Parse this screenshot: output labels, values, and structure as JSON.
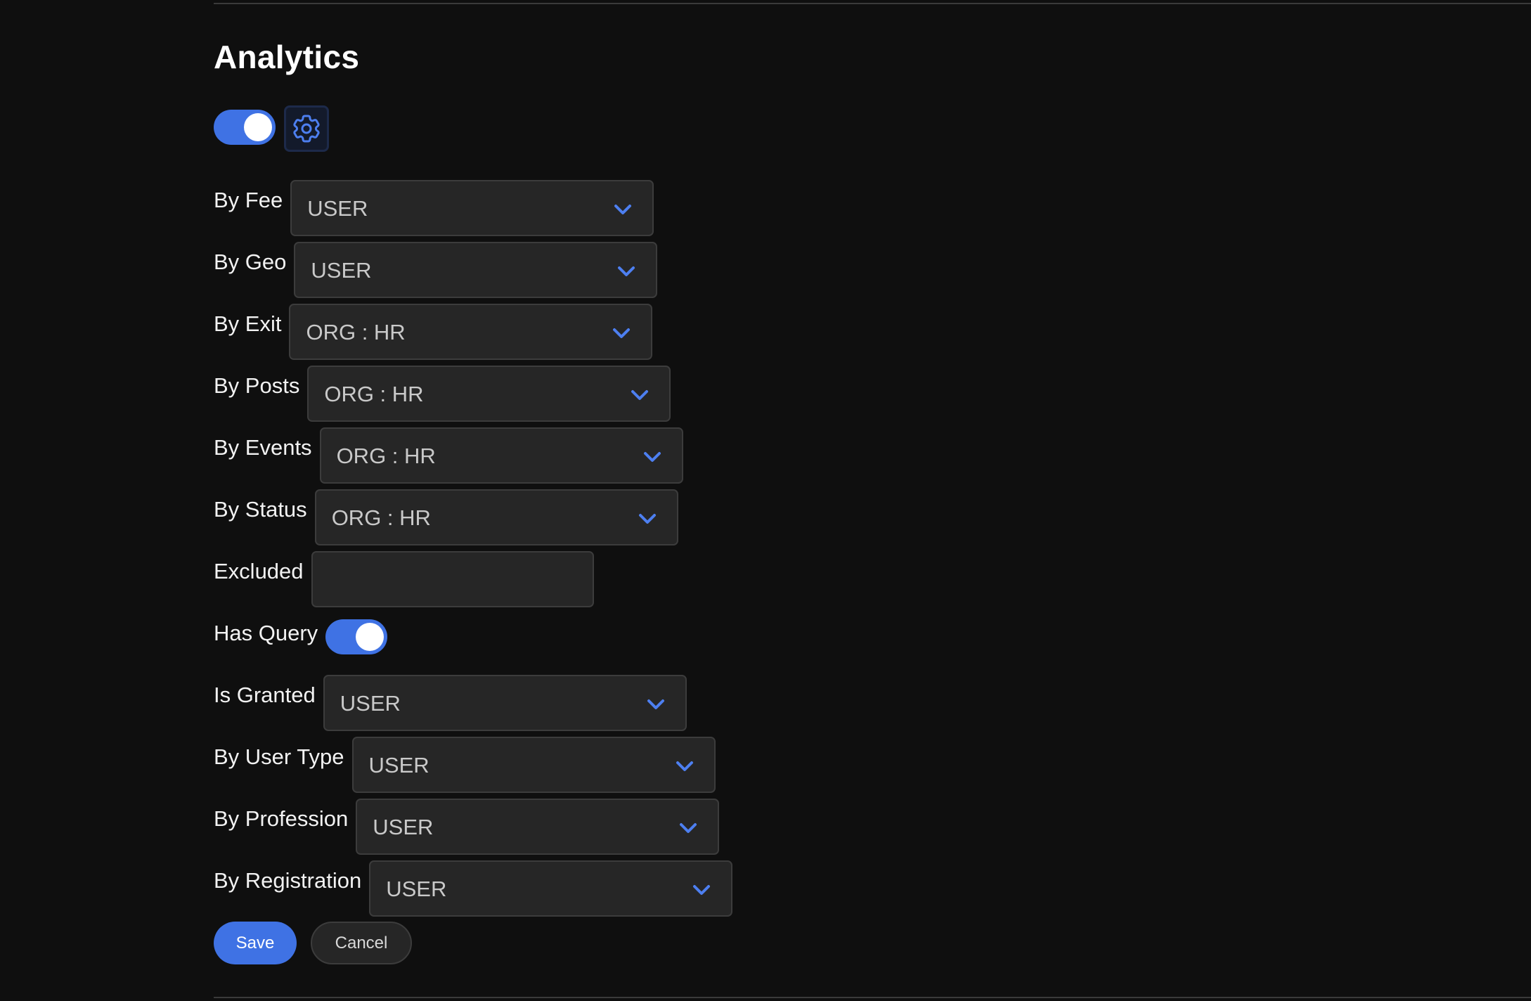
{
  "section": {
    "title": "Analytics",
    "enabled": true,
    "settings_icon": "gear-icon"
  },
  "fields": [
    {
      "label": "By Fee",
      "type": "select",
      "value": "USER"
    },
    {
      "label": "By Geo",
      "type": "select",
      "value": "USER"
    },
    {
      "label": "By Exit",
      "type": "select",
      "value": "ORG : HR"
    },
    {
      "label": "By Posts",
      "type": "select",
      "value": "ORG : HR"
    },
    {
      "label": "By Events",
      "type": "select",
      "value": "ORG : HR"
    },
    {
      "label": "By Status",
      "type": "select",
      "value": "ORG : HR"
    },
    {
      "label": "Excluded",
      "type": "text",
      "value": ""
    },
    {
      "label": "Has Query",
      "type": "toggle",
      "value": true
    },
    {
      "label": "Is Granted",
      "type": "select",
      "value": "USER"
    },
    {
      "label": "By User Type",
      "type": "select",
      "value": "USER"
    },
    {
      "label": "By Profession",
      "type": "select",
      "value": "USER"
    },
    {
      "label": "By Registration",
      "type": "select",
      "value": "USER"
    }
  ],
  "actions": {
    "save_label": "Save",
    "cancel_label": "Cancel"
  },
  "colors": {
    "background": "#0f0f0f",
    "accent": "#3f72e4",
    "field_bg": "#262626",
    "chevron": "#4d7ff0"
  }
}
